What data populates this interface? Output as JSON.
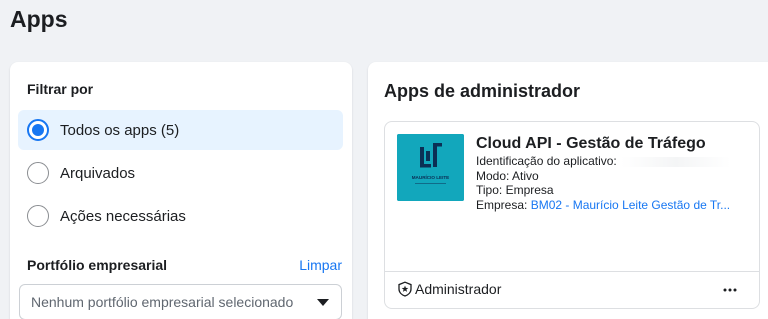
{
  "page": {
    "title": "Apps"
  },
  "filter": {
    "heading": "Filtrar por",
    "options": [
      {
        "label": "Todos os apps (5)",
        "selected": true
      },
      {
        "label": "Arquivados",
        "selected": false
      },
      {
        "label": "Ações necessárias",
        "selected": false
      }
    ],
    "portfolio": {
      "label": "Portfólio empresarial",
      "clear_label": "Limpar",
      "placeholder": "Nenhum portfólio empresarial selecionado"
    }
  },
  "admin_apps": {
    "heading": "Apps de administrador",
    "app": {
      "name": "Cloud API - Gestão de Tráfego",
      "logo_text": "MAURÍCIO LEITE",
      "id_label": "Identificação do aplicativo:",
      "mode": "Modo: Ativo",
      "type": "Tipo: Empresa",
      "company_label": "Empresa:",
      "company_value": "BM02 - Maurício Leite Gestão de Tr...",
      "role": "Administrador",
      "more_label": "•••"
    }
  },
  "colors": {
    "accent": "#1877f2",
    "selected_bg": "#e7f3ff",
    "logo_bg": "#12a7bc",
    "page_bg": "#f0f2f5"
  },
  "icons": {
    "radio": "radio-circle-icon",
    "select_caret": "caret-down-icon",
    "role": "star-shield-icon",
    "more": "more-horizontal-icon"
  }
}
